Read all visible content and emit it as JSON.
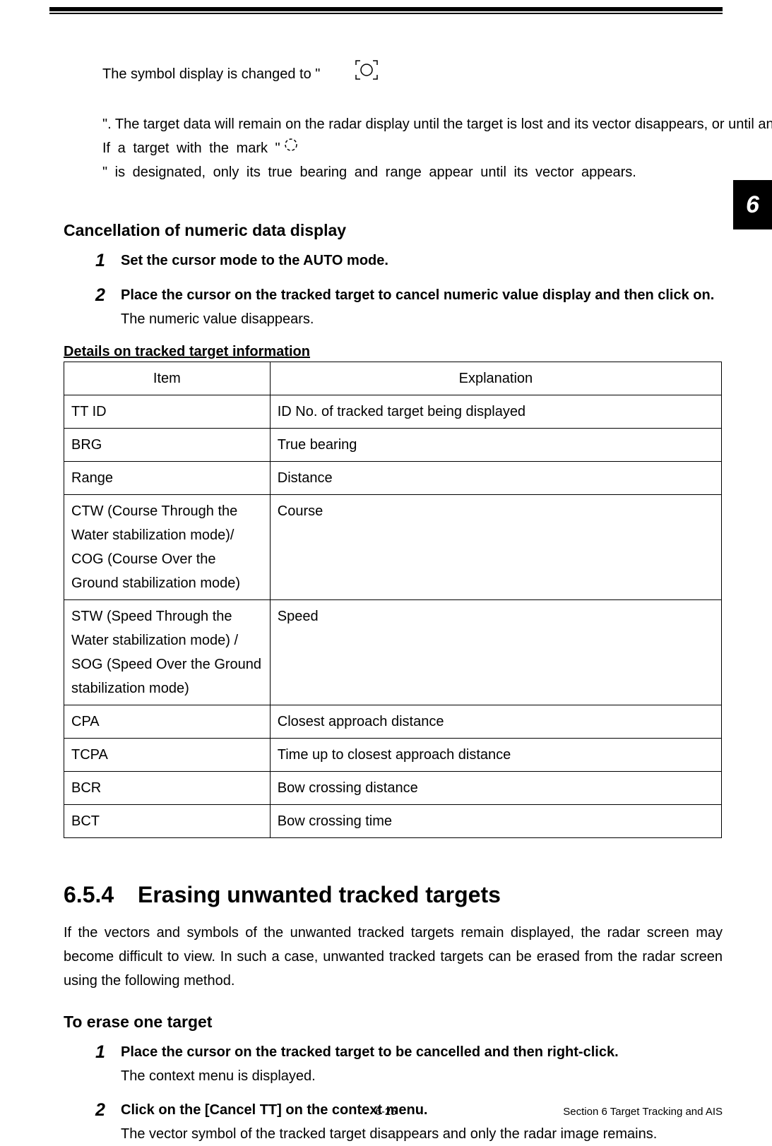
{
  "intro": {
    "part1": "The symbol display is changed to \"",
    "part2": "\". The target data will remain on the radar display until the target is lost and its vector disappears, or until another target is designated.",
    "part3a": "If a target with the mark \"",
    "part3b": "\" is designated, only its true bearing and range appear until its vector appears."
  },
  "cancel": {
    "heading": "Cancellation of numeric data display",
    "steps": [
      {
        "num": "1",
        "bold": "Set the cursor mode to the AUTO mode."
      },
      {
        "num": "2",
        "bold": "Place the cursor on the tracked target to cancel numeric value display and then click on.",
        "desc": "The numeric value disappears."
      }
    ]
  },
  "table": {
    "title": "Details on tracked target information",
    "header": {
      "item": "Item",
      "exp": "Explanation"
    },
    "rows": [
      {
        "item": "TT ID",
        "exp": "ID No. of tracked target being displayed"
      },
      {
        "item": "BRG",
        "exp": "True bearing"
      },
      {
        "item": "Range",
        "exp": "Distance"
      },
      {
        "item": "CTW (Course Through the Water stabilization mode)/ COG (Course Over the Ground stabilization mode)",
        "exp": "Course"
      },
      {
        "item": "STW (Speed Through the Water stabilization mode) / SOG (Speed Over the Ground stabilization mode)",
        "exp": "Speed"
      },
      {
        "item": "CPA",
        "exp": "Closest approach distance"
      },
      {
        "item": "TCPA",
        "exp": "Time up to closest approach distance"
      },
      {
        "item": "BCR",
        "exp": "Bow crossing distance"
      },
      {
        "item": "BCT",
        "exp": "Bow crossing time"
      }
    ]
  },
  "section": {
    "num": "6.5.4",
    "title": "Erasing unwanted tracked targets",
    "para": "If the vectors and symbols of the unwanted tracked targets remain displayed, the radar screen may become difficult to view. In such a case, unwanted tracked targets can be erased from the radar screen using the following method."
  },
  "erase": {
    "heading": "To erase one target",
    "steps": [
      {
        "num": "1",
        "bold": "Place the cursor on the tracked target to be cancelled and then right-click.",
        "desc": "The context menu is displayed."
      },
      {
        "num": "2",
        "bold": "Click on the [Cancel TT] on the context menu.",
        "desc": "The vector symbol of the tracked target disappears and only the radar image remains."
      }
    ]
  },
  "tab": "6",
  "footer": {
    "page": "6-25",
    "section": "Section 6    Target Tracking and AIS"
  }
}
